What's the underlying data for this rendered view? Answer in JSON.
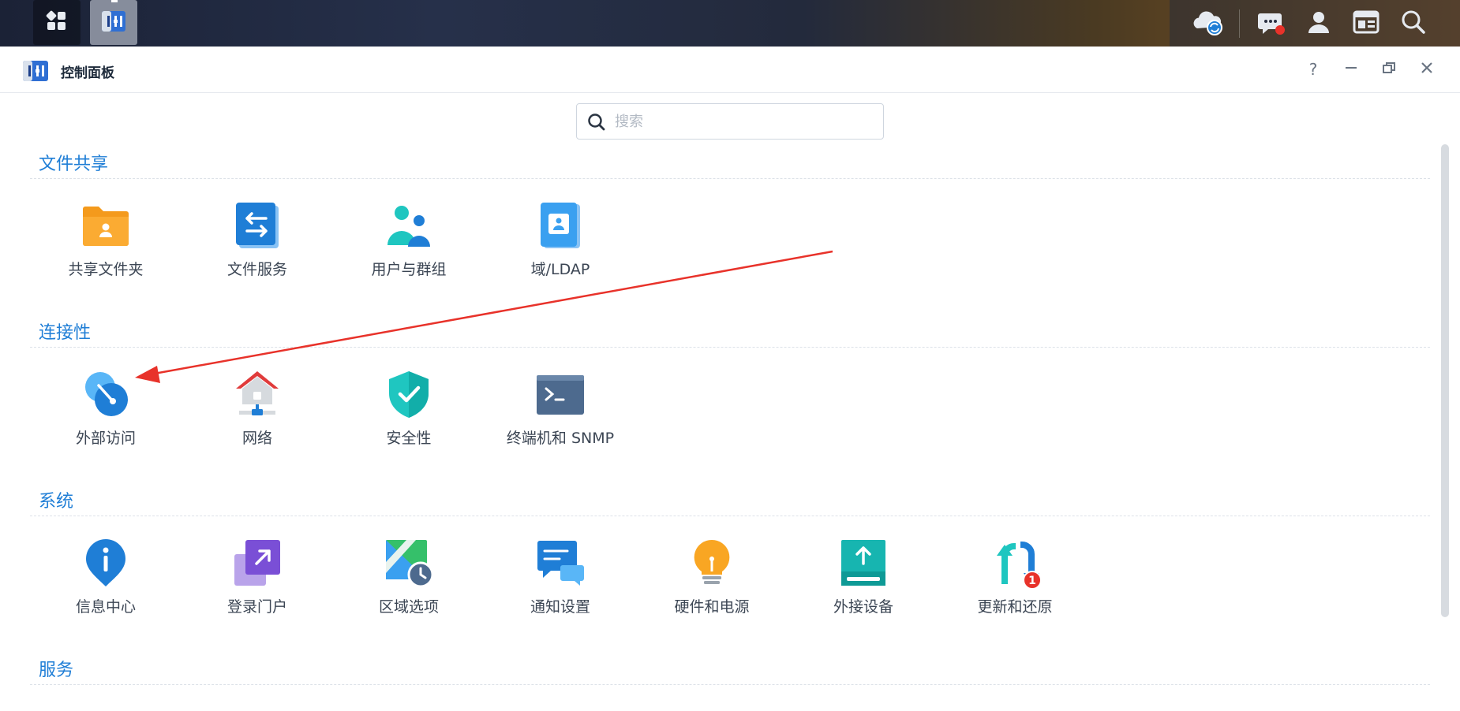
{
  "window": {
    "title": "控制面板",
    "help_label": "?",
    "colors": {
      "accent": "#1f7ed6",
      "text": "#3c4654"
    }
  },
  "search": {
    "placeholder": "搜索"
  },
  "sections": [
    {
      "title": "文件共享",
      "items": [
        {
          "label": "共享文件夹",
          "icon": "shared-folder-icon"
        },
        {
          "label": "文件服务",
          "icon": "file-services-icon"
        },
        {
          "label": "用户与群组",
          "icon": "user-group-icon"
        },
        {
          "label": "域/LDAP",
          "icon": "domain-ldap-icon"
        }
      ]
    },
    {
      "title": "连接性",
      "items": [
        {
          "label": "外部访问",
          "icon": "external-access-icon"
        },
        {
          "label": "网络",
          "icon": "network-icon"
        },
        {
          "label": "安全性",
          "icon": "security-shield-icon"
        },
        {
          "label": "终端机和 SNMP",
          "icon": "terminal-icon"
        }
      ]
    },
    {
      "title": "系统",
      "items": [
        {
          "label": "信息中心",
          "icon": "info-center-icon"
        },
        {
          "label": "登录门户",
          "icon": "login-portal-icon"
        },
        {
          "label": "区域选项",
          "icon": "regional-options-icon"
        },
        {
          "label": "通知设置",
          "icon": "notification-icon"
        },
        {
          "label": "硬件和电源",
          "icon": "hardware-power-icon"
        },
        {
          "label": "外接设备",
          "icon": "external-devices-icon"
        },
        {
          "label": "更新和还原",
          "icon": "update-restore-icon",
          "badge": "1"
        }
      ]
    },
    {
      "title": "服务",
      "items": []
    }
  ],
  "annotation": {
    "type": "red-arrow",
    "color": "#e8322a",
    "points_to": "外部访问"
  }
}
